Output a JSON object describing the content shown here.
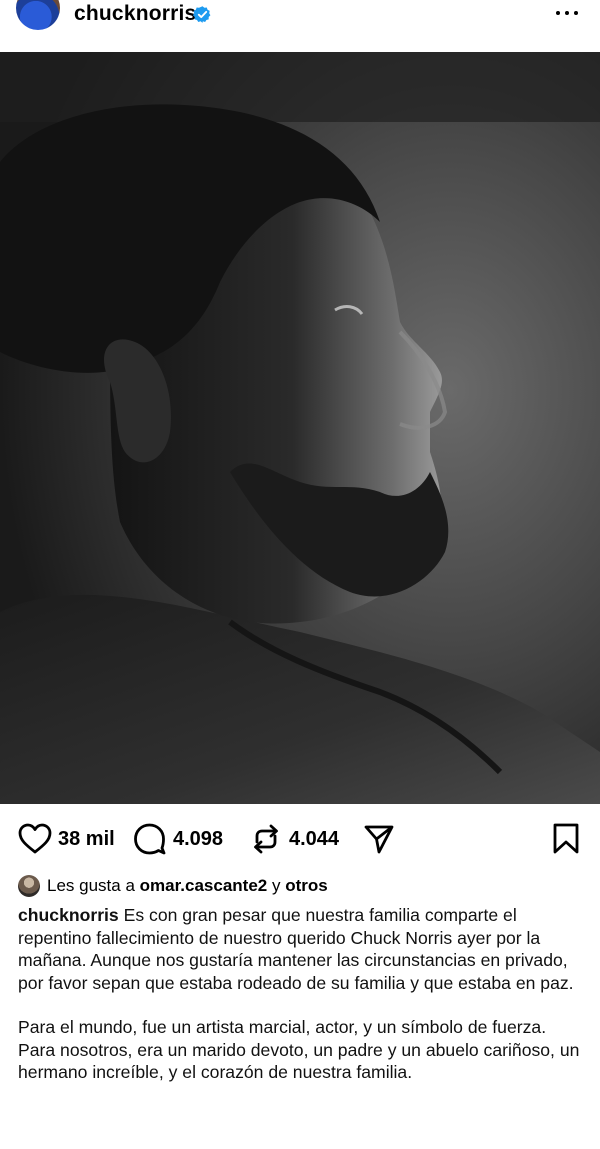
{
  "header": {
    "username": "chucknorris",
    "verified": true,
    "more_icon": "more-horizontal-icon"
  },
  "post_image": {
    "description_icon": "photo"
  },
  "actions": {
    "likes_count": "38 mil",
    "comments_count": "4.098",
    "reposts_count": "4.044",
    "icons": [
      "heart-icon",
      "comment-icon",
      "repost-icon",
      "share-icon",
      "bookmark-icon"
    ]
  },
  "liked_by": {
    "prefix": "Les gusta a",
    "user": "omar.cascante2",
    "connector": "y",
    "others": "otros"
  },
  "caption": {
    "author": "chucknorris",
    "paragraph1_text": "Es con gran pesar que nuestra familia comparte el repentino fallecimiento de nuestro querido Chuck Norris ayer por la mañana. Aunque nos gustaría mantener las circunstancias en privado, por favor sepan que estaba rodeado de su familia y que estaba en paz.",
    "paragraph2_text": "Para el mundo, fue un artista marcial, actor, y un símbolo de fuerza. Para nosotros, era un marido devoto, un padre y un abuelo cariñoso, un hermano increíble, y el corazón de nuestra familia."
  }
}
